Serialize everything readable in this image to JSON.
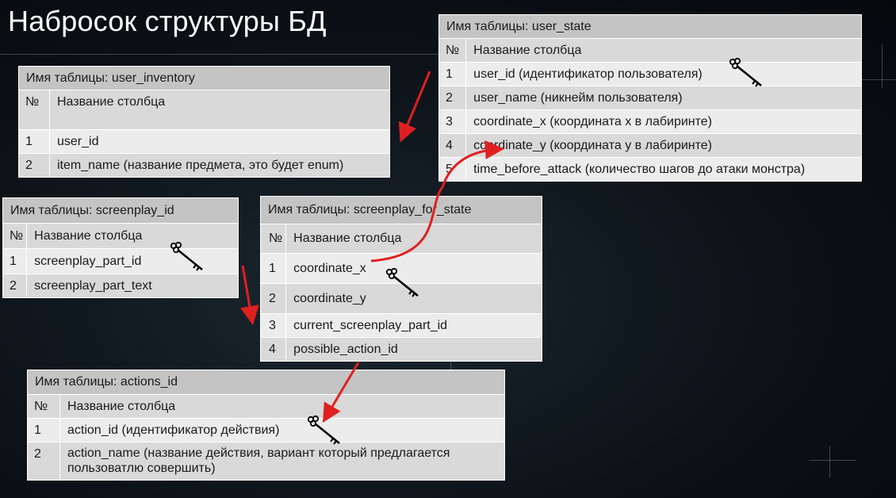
{
  "title": "Набросок структуры БД",
  "tables": {
    "user_state": {
      "header": "Имя таблицы: user_state",
      "col_num": "№",
      "col_name": "Название столбца",
      "rows": [
        {
          "n": "1",
          "name": "user_id (идентификатор пользователя)"
        },
        {
          "n": "2",
          "name": "user_name (никнейм пользователя)"
        },
        {
          "n": "3",
          "name": "coordinate_x (координата x в лабиринте)"
        },
        {
          "n": "4",
          "name": "coordinate_y (координата y в лабиринте)"
        },
        {
          "n": "5",
          "name": "time_before_attack (количество шагов до атаки монстра)"
        }
      ]
    },
    "user_inventory": {
      "header": "Имя таблицы: user_inventory",
      "col_num": "№",
      "col_name": "Название столбца",
      "rows": [
        {
          "n": "1",
          "name": "user_id"
        },
        {
          "n": "2",
          "name": "item_name (название предмета, это будет enum)"
        }
      ]
    },
    "screenplay_id": {
      "header": "Имя таблицы: screenplay_id",
      "col_num": "№",
      "col_name": "Название столбца",
      "rows": [
        {
          "n": "1",
          "name": "screenplay_part_id"
        },
        {
          "n": "2",
          "name": "screenplay_part_text"
        }
      ]
    },
    "screenplay_for_state": {
      "header": "Имя таблицы: screenplay_for_state",
      "col_num": "№",
      "col_name": "Название столбца",
      "rows": [
        {
          "n": "1",
          "name": "coordinate_x"
        },
        {
          "n": "2",
          "name": "coordinate_y"
        },
        {
          "n": "3",
          "name": "current_screenplay_part_id"
        },
        {
          "n": "4",
          "name": "possible_action_id"
        }
      ]
    },
    "actions_id": {
      "header": "Имя таблицы: actions_id",
      "col_num": "№",
      "col_name": "Название столбца",
      "rows": [
        {
          "n": "1",
          "name": "action_id (идентификатор действия)"
        },
        {
          "n": "2",
          "name": "action_name (название действия, вариант который предлагается пользоватлю совершить)"
        }
      ]
    }
  },
  "colors": {
    "arrow": "#e02020",
    "header_bg": "#c4c4c4",
    "row_dark": "#d9d9d9",
    "row_light": "#ececec"
  },
  "icons": [
    "key-icon"
  ]
}
